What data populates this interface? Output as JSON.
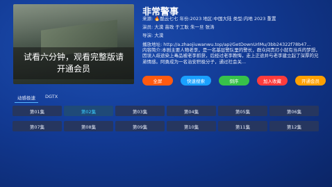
{
  "player": {
    "overlay_text": "试看六分钟，观看完整版请开通会员"
  },
  "info": {
    "title": "非常警事",
    "line1": {
      "source_label": "来源:",
      "source_value": "酷云七七",
      "year_label": "年份:",
      "year_value": "2023",
      "region_label": "地区:",
      "region_value": "中国大陆",
      "type_label": "类型:",
      "type_value": "内地 2023 重置"
    },
    "cast_label": "演员:",
    "cast_value": "大漠 苗政 于工耿 朱一旦 张涛",
    "director_label": "导演:",
    "director_value": "大漠",
    "url_label": "播放地址:",
    "url_value": "http://a.zhaojiuwanwu.top/api/GetDownUrlMu/3bb24322f78b47...",
    "desc_label": "内容简介:",
    "desc_value": "本剧主要人物老李，是一名基层警队里的警长，群众间责打小就有当兵的梦想，因误入歧途染上毒品被老李抓获，后经过老李教悔，走上正途并与老李建立起了深厚的兄弟情感。阿勇成为一名治安积极分子，通过社会关..."
  },
  "buttons": [
    {
      "label": "全屏",
      "color": "#ff5a10"
    },
    {
      "label": "快速搜索",
      "color": "#1aa0ff"
    },
    {
      "label": "倒序",
      "color": "#37c24a"
    },
    {
      "label": "加入收藏",
      "color": "#ff3c3c"
    },
    {
      "label": "开通会员",
      "color": "#ffa000"
    }
  ],
  "sources": [
    {
      "label": "动感极速",
      "active": true
    },
    {
      "label": "DGTX",
      "active": false
    }
  ],
  "episodes": [
    {
      "label": "第01集",
      "active": false
    },
    {
      "label": "第02集",
      "active": true
    },
    {
      "label": "第03集",
      "active": false
    },
    {
      "label": "第04集",
      "active": false
    },
    {
      "label": "第05集",
      "active": false
    },
    {
      "label": "第06集",
      "active": false
    },
    {
      "label": "第07集",
      "active": false
    },
    {
      "label": "第08集",
      "active": false
    },
    {
      "label": "第09集",
      "active": false
    },
    {
      "label": "第10集",
      "active": false
    },
    {
      "label": "第11集",
      "active": false
    },
    {
      "label": "第12集",
      "active": false
    }
  ]
}
